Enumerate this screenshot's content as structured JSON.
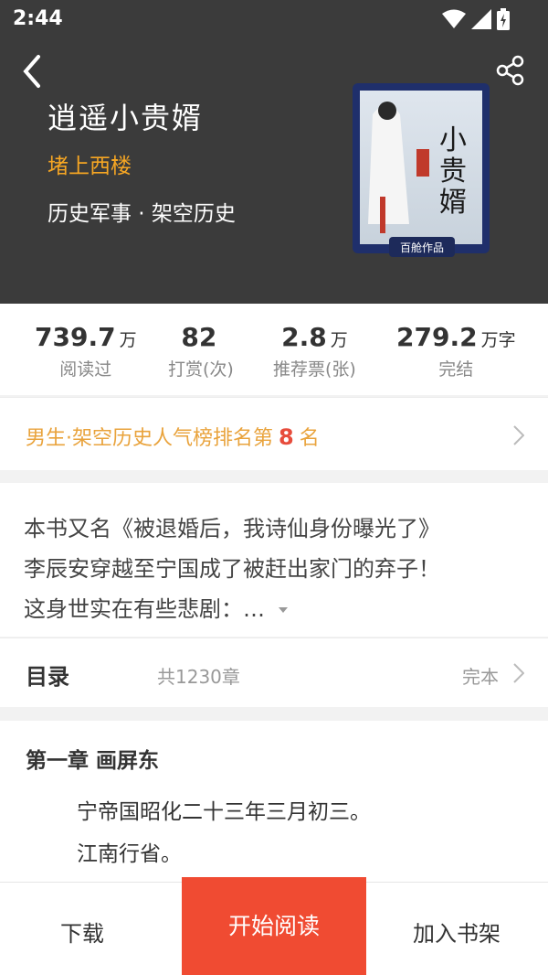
{
  "status_bar": {
    "time": "2:44",
    "icons": [
      "wifi-icon",
      "signal-icon",
      "battery-icon"
    ]
  },
  "book": {
    "title": "逍遥小贵婿",
    "author": "堵上西楼",
    "category": "历史军事 · 架空历史",
    "cover_title": "小贵婿",
    "cover_badge": "百舱作品"
  },
  "stats": [
    {
      "value": "739.7",
      "unit": "万",
      "label": "阅读过"
    },
    {
      "value": "82",
      "unit": "",
      "label": "打赏(次)"
    },
    {
      "value": "2.8",
      "unit": "万",
      "label": "推荐票(张)"
    },
    {
      "value": "279.2",
      "unit": "万字",
      "label": "完结"
    }
  ],
  "rank": {
    "prefix": "男生·架空历史人气榜排名第",
    "number": "8",
    "suffix": "名"
  },
  "intro": {
    "lines": [
      "本书又名《被退婚后，我诗仙身份曝光了》",
      "李辰安穿越至宁国成了被赶出家门的弃子！",
      "这身世实在有些悲剧：…"
    ]
  },
  "toc": {
    "title": "目录",
    "count": "共1230章",
    "status": "完本"
  },
  "chapter": {
    "title": "第一章 画屏东",
    "lines": [
      "宁帝国昭化二十三年三月初三。",
      "江南行省。"
    ]
  },
  "actions": {
    "download": "下载",
    "start_reading": "开始阅读",
    "add_to_shelf": "加入书架"
  },
  "colors": {
    "header_bg": "#3b3b3b",
    "author": "#f6a623",
    "rank_text": "#e9a33c",
    "rank_number": "#e74c3c",
    "primary_button": "#f04b32"
  }
}
